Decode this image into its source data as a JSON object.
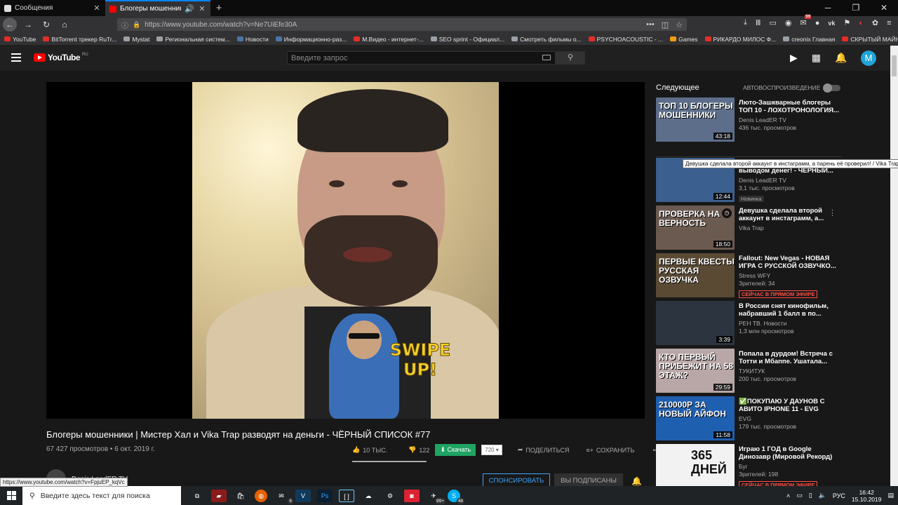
{
  "browser": {
    "tabs": [
      {
        "label": "Сообщения",
        "icon_color": "#ffffff"
      },
      {
        "label": "Блогеры мошенники | Ми",
        "icon_color": "#ff0000"
      }
    ],
    "url": "https://www.youtube.com/watch?v=Ne7UiEfe30A",
    "bookmarks": [
      "YouTube",
      "BitTorrent трекер RuTr...",
      "Mystat",
      "Региональная систем...",
      "Новости",
      "Информационно-раз...",
      "М.Видео - интернет-...",
      "SEO sprint - Официал...",
      "Смотреть фильмы о...",
      "PSYCHOACOUSTIC - ...",
      "Games",
      "РИКАРДО МИЛОС Ф...",
      "creonix Главная",
      "СКРЫТЫЙ МАЙНЕР В..."
    ],
    "status_url": "https://www.youtube.com/watch?v=FpjuEP_kqVc",
    "notif_badge": "99"
  },
  "youtube": {
    "logo": "YouTube",
    "logo_region": "RU",
    "search_placeholder": "Введите запрос",
    "avatar_letter": "M",
    "accent": "#ff0000"
  },
  "video": {
    "overlay_text": "SWIPE UP!",
    "title": "Блогеры мошенники | Мистер Хал и Vika Trap разводят на деньги - ЧЁРНЫЙ СПИСОК #77",
    "meta": "67 427 просмотров • 6 окт. 2019 г.",
    "likes": "10 ТЫС.",
    "dislikes": "122",
    "download_label": "Скачать",
    "quality": "720",
    "share_label": "ПОДЕЛИТЬСЯ",
    "save_label": "СОХРАНИТЬ",
    "channel": "Denis LeadER TV",
    "sponsor_label": "СПОНСИРОВАТЬ",
    "subscribed_label": "ВЫ ПОДПИСАНЫ",
    "like_ratio": 0.99
  },
  "sidebar": {
    "up_next": "Следующее",
    "autoplay": "АВТОВОСПРОИЗВЕДЕНИЕ",
    "recommendations": [
      {
        "title": "Люто-Зашкварные блогеры ТОП 10 - ЛОХОТРОНОЛОГИЯ...",
        "channel": "Denis LeadER TV",
        "views": "436 тыс. просмотров",
        "badge": "",
        "duration": "43:18",
        "thumb_text": "ТОП 10 БЛОГЕРЫ МОШЕННИКИ",
        "bg": "#5c6e8a"
      },
      {
        "title": "Тактики? Разоблачение игр с выводом денег! - ЧЁРНЫЙ...",
        "channel": "Denis LeadER TV",
        "views": "3,1 тыс. просмотров",
        "badge": "Новинка",
        "duration": "12:44",
        "thumb_text": "",
        "bg": "#3b5f8e"
      },
      {
        "title": "Девушка сделала второй аккаунт в инстаграмм, а...",
        "channel": "Vika Trap",
        "views": "",
        "badge": "",
        "duration": "18:50",
        "thumb_text": "ПРОВЕРКА НА ВЕРНОСТЬ",
        "bg": "#6b5a50"
      },
      {
        "title": "Fallout: New Vegas - НОВАЯ ИГРА С РУССКОЙ ОЗВУЧКО...",
        "channel": "Stress WFY",
        "views": "Зрителей: 34",
        "badge": "СЕЙЧАС В ПРЯМОМ ЭФИРЕ",
        "duration": "",
        "thumb_text": "ПЕРВЫЕ КВЕСТЫ РУССКАЯ ОЗВУЧКА",
        "bg": "#5a4a34"
      },
      {
        "title": "В России снят кинофильм, набравший 1 балл в по...",
        "channel": "РЕН ТВ. Новости",
        "views": "1,3 млн просмотров",
        "badge": "",
        "duration": "3:39",
        "thumb_text": "",
        "bg": "#2c3440"
      },
      {
        "title": "Попала в дурдом! Встреча с Тотти и Мбаппе. Ушатала...",
        "channel": "ТУКИТУК",
        "views": "200 тыс. просмотров",
        "badge": "",
        "duration": "29:59",
        "thumb_text": "КТО ПЕРВЫЙ ПРИБЕЖИТ НА 58 ЭТАЖ?",
        "bg": "#b9a6a6"
      },
      {
        "title": "✅ПОКУПАЮ У ДАУНОВ С АВИТО IPHONE 11 - EVG",
        "channel": "EVG",
        "views": "179 тыс. просмотров",
        "badge": "",
        "duration": "11:58",
        "thumb_text": "210000Р ЗА НОВЫЙ АЙФОН",
        "bg": "#1f5fb0"
      },
      {
        "title": "Играю 1 ГОД в Google Динозавр (Мировой Рекорд)",
        "channel": "Буг",
        "views": "Зрителей: 198",
        "badge": "СЕЙЧАС В ПРЯМОМ ЭФИРЕ",
        "duration": "",
        "thumb_text": "365 ДНЕЙ",
        "bg": "#f2f2f2"
      }
    ],
    "tooltip": "Девушка сделала второй аккаунт в инстаграмм, а парень её проверил! / Vika Trap"
  },
  "taskbar": {
    "search_placeholder": "Введите здесь текст для поиска",
    "lang": "РУС",
    "time": "16:42",
    "date": "15.10.2019",
    "badge_count_1": "99+",
    "badge_count_2": "48"
  }
}
